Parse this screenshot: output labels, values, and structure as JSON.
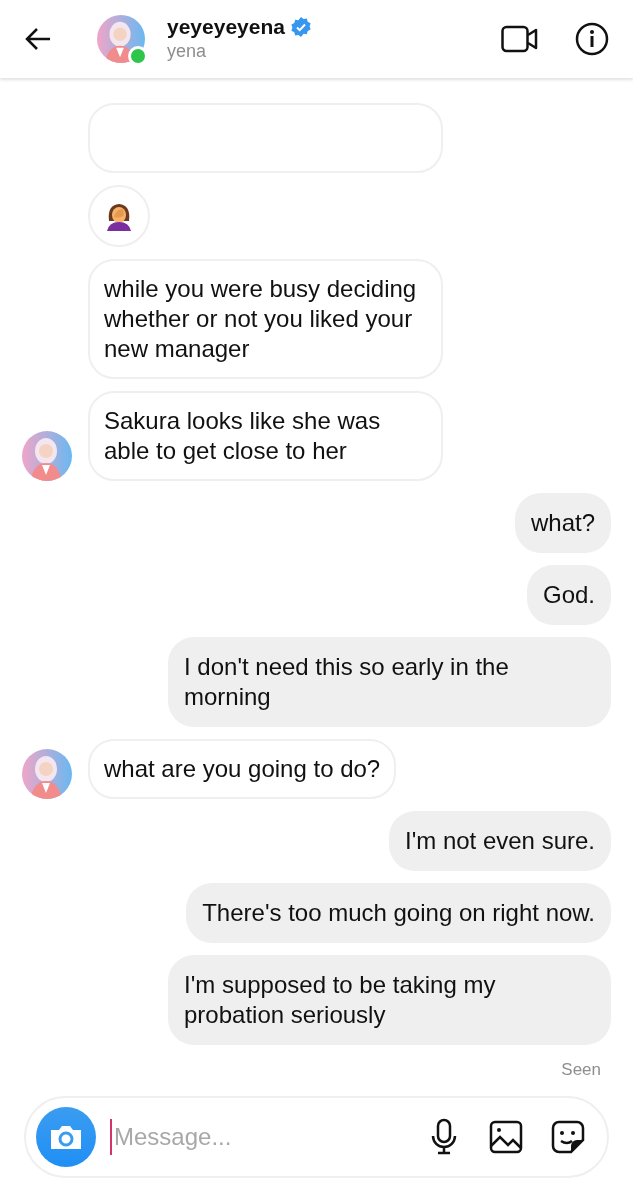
{
  "header": {
    "username": "yeyeyeyena",
    "verified": true,
    "subtitle": "yena",
    "online": true
  },
  "messages": [
    {
      "kind": "cut",
      "sent": false,
      "avatar": false
    },
    {
      "kind": "emoji",
      "sent": false,
      "avatar": false
    },
    {
      "kind": "text",
      "sent": false,
      "text": "while you were busy deciding whether or not you liked your new manager",
      "avatar": false
    },
    {
      "kind": "text",
      "sent": false,
      "text": "Sakura looks like she was able to get close to her",
      "avatar": true
    },
    {
      "kind": "text",
      "sent": true,
      "text": "what?"
    },
    {
      "kind": "text",
      "sent": true,
      "text": "God."
    },
    {
      "kind": "text",
      "sent": true,
      "text": "I don't need this so early in the morning"
    },
    {
      "kind": "text",
      "sent": false,
      "text": "what are you going to do?",
      "avatar": true
    },
    {
      "kind": "text",
      "sent": true,
      "text": "I'm not even sure."
    },
    {
      "kind": "text",
      "sent": true,
      "text": "There's too much going on right now."
    },
    {
      "kind": "text",
      "sent": true,
      "text": "I'm supposed to be taking my probation seriously"
    }
  ],
  "seen": "Seen",
  "composer": {
    "placeholder": "Message..."
  }
}
